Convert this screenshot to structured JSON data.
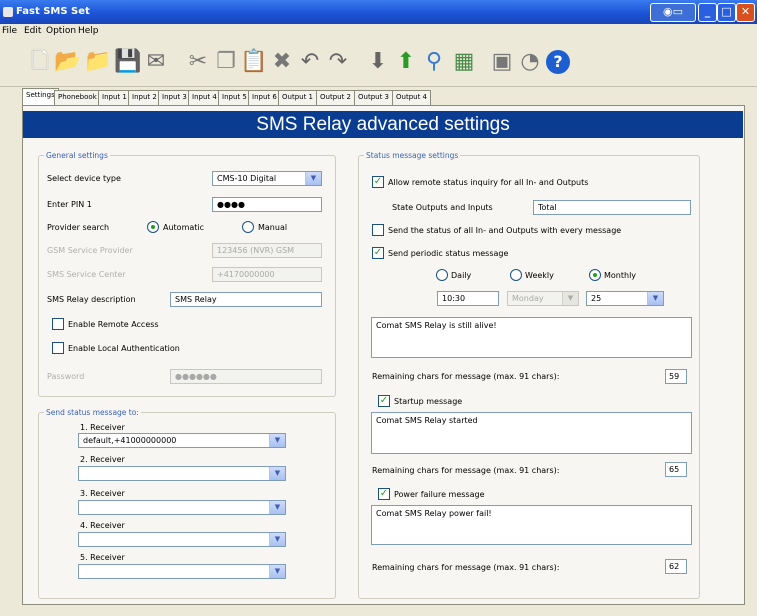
{
  "window": {
    "title": "Fast SMS Set"
  },
  "menu": [
    "File",
    "Edit",
    "Option",
    "Help"
  ],
  "toolbar": {
    "icons": [
      "new-icon",
      "open-icon",
      "open-folder-icon",
      "save-icon",
      "send-icon",
      "cut-icon",
      "copy-icon",
      "paste-icon",
      "delete-icon",
      "undo-icon",
      "redo-icon",
      "download-icon",
      "upload-icon",
      "search-icon",
      "network-icon",
      "device-icon",
      "connect-icon",
      "help-icon"
    ]
  },
  "tabs": [
    "Settings",
    "Phonebook",
    "Input 1",
    "Input 2",
    "Input 3",
    "Input 4",
    "Input 5",
    "Input 6",
    "Output 1",
    "Output 2",
    "Output 3",
    "Output 4"
  ],
  "header": {
    "title": "SMS Relay advanced settings"
  },
  "general": {
    "group_label": "General settings",
    "device_type_label": "Select device type",
    "device_type_value": "CMS-10 Digital",
    "pin_label": "Enter PIN 1",
    "pin_value": "●●●●",
    "provider_label": "Provider search",
    "provider_auto": "Automatic",
    "provider_manual": "Manual",
    "gsm_service_label": "GSM Service Provider",
    "gsm_service_value": "123456 (NVR) GSM",
    "sms_center_label": "SMS Service Center",
    "sms_center_value": "+4170000000",
    "description_label": "SMS Relay description",
    "description_value": "SMS Relay",
    "remote_access_label": "Enable Remote Access",
    "local_auth_label": "Enable Local Authentication",
    "password_label": "Password",
    "password_value": "●●●●●●"
  },
  "send_status": {
    "group_label": "Send status message to:",
    "receivers": [
      {
        "label": "1. Receiver",
        "value": "default,+41000000000"
      },
      {
        "label": "2. Receiver",
        "value": ""
      },
      {
        "label": "3. Receiver",
        "value": ""
      },
      {
        "label": "4. Receiver",
        "value": ""
      },
      {
        "label": "5. Receiver",
        "value": ""
      }
    ]
  },
  "status_settings": {
    "group_label": "Status message settings",
    "allow_remote_label": "Allow remote status inquiry for all In- and Outputs",
    "allow_remote_checked": true,
    "state_label": "State Outputs and Inputs",
    "state_value": "Total",
    "send_status_every_label": "Send the status of all In- and Outputs with every message",
    "send_status_every_checked": false,
    "periodic_label": "Send periodic status message",
    "periodic_checked": true,
    "period_daily": "Daily",
    "period_weekly": "Weekly",
    "period_monthly": "Monthly",
    "period_selected": "Monthly",
    "time_value": "10:30",
    "weekday_value": "Monday",
    "day_value": "25",
    "periodic_message": "Comat SMS Relay is still alive!",
    "remaining_label": "Remaining chars for message (max. 91 chars):",
    "periodic_remaining": "59",
    "startup_label": "Startup message",
    "startup_checked": true,
    "startup_message": "Comat SMS Relay started",
    "startup_remaining": "65",
    "power_label": "Power failure message",
    "power_checked": true,
    "power_message": "Comat SMS Relay power fail!",
    "power_remaining": "62"
  },
  "colors": {
    "banner": "#0a3d91",
    "title_bar": "#1c54d6",
    "check": "#21a121"
  }
}
